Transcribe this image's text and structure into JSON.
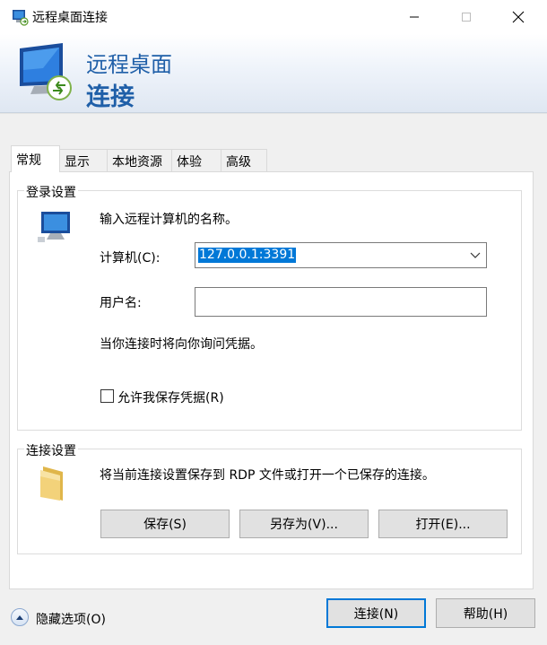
{
  "window": {
    "title": "远程桌面连接",
    "icon": "remote-desktop-icon",
    "controls": [
      "minimize-icon",
      "maximize-icon",
      "close-icon"
    ]
  },
  "banner": {
    "line1": "远程桌面",
    "line2": "连接",
    "accent_color": "#1f5fa8"
  },
  "tabs": [
    {
      "label": "常规",
      "active": true
    },
    {
      "label": "显示",
      "active": false
    },
    {
      "label": "本地资源",
      "active": false
    },
    {
      "label": "体验",
      "active": false
    },
    {
      "label": "高级",
      "active": false
    }
  ],
  "logon": {
    "legend": "登录设置",
    "icon": "computer-icon",
    "instruction": "输入远程计算机的名称。",
    "computer_label": "计算机(C):",
    "computer_value": "127.0.0.1:3391",
    "username_label": "用户名:",
    "username_value": "",
    "prompt_note": "当你连接时将向你询问凭据。",
    "save_credentials_label": "允许我保存凭据(R)",
    "save_credentials_checked": false
  },
  "connection": {
    "legend": "连接设置",
    "icon": "folder-icon",
    "description": "将当前连接设置保存到 RDP 文件或打开一个已保存的连接。",
    "save_label": "保存(S)",
    "save_as_label": "另存为(V)...",
    "open_label": "打开(E)..."
  },
  "footer": {
    "hide_options_label": "隐藏选项(O)",
    "connect_label": "连接(N)",
    "help_label": "帮助(H)"
  },
  "colors": {
    "selection": "#0078d7",
    "primary_border": "#0078d7"
  }
}
